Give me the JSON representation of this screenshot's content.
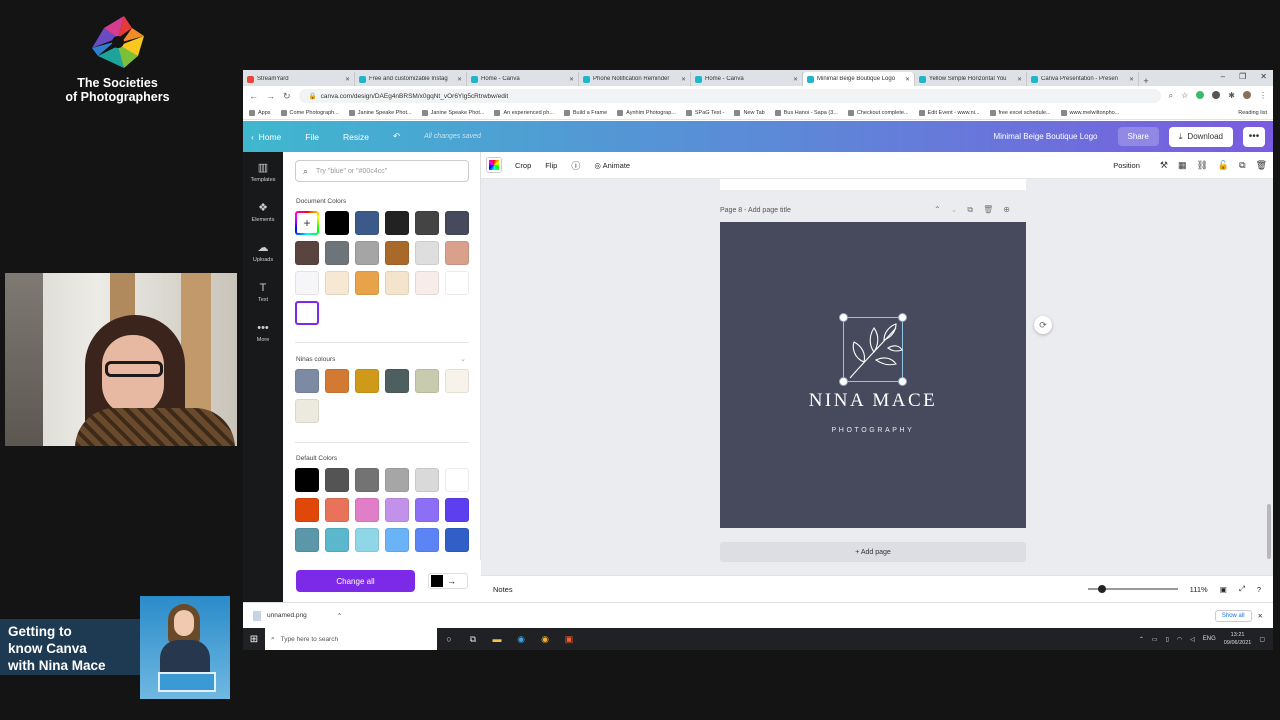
{
  "overlay": {
    "org_line1": "The Societies",
    "org_line2": "of Photographers",
    "promo_line1": "Getting to",
    "promo_line2": "know Canva",
    "promo_line3": "with Nina Mace"
  },
  "browser": {
    "tabs": [
      {
        "label": "StreamYard",
        "color": "#e8453c",
        "active": false
      },
      {
        "label": "Free and customizable Instag",
        "color": "#1fb6c9",
        "active": false
      },
      {
        "label": "Home - Canva",
        "color": "#1fb6c9",
        "active": false
      },
      {
        "label": "Phone Notification Reminder",
        "color": "#1fb6c9",
        "active": false
      },
      {
        "label": "Home - Canva",
        "color": "#1fb6c9",
        "active": false
      },
      {
        "label": "Minimal Beige Boutique Logo",
        "color": "#1fb6c9",
        "active": true
      },
      {
        "label": "Yellow Simple Horizontal You",
        "color": "#1fb6c9",
        "active": false
      },
      {
        "label": "Canva Presentation - Presen",
        "color": "#1fb6c9",
        "active": false
      }
    ],
    "new_tab": "+",
    "url": "canva.com/design/DAEg4nBRSM/x0gqNt_vOr6Ylg5cRtrwbw/edit",
    "bookmarks": [
      "Apps",
      "Come Photograph...",
      "Janine Speake Phot...",
      "Janine Speake Phot...",
      "An experienced ph...",
      "Build a Frame",
      "Aynhim Photograp...",
      "SPaG Test -",
      "New Tab",
      "Bus Hanoi - Sapa (3...",
      "Checkout complete...",
      "Edit Event - www.ni...",
      "free excel schedule...",
      "www.melwiltonpho..."
    ],
    "reading_list": "Reading list"
  },
  "canva": {
    "header": {
      "home": "Home",
      "file": "File",
      "resize": "Resize",
      "saved": "All changes saved",
      "design_title": "Minimal Beige Boutique Logo",
      "share": "Share",
      "download": "Download"
    },
    "rail": [
      {
        "label": "Templates",
        "icon": "▥"
      },
      {
        "label": "Elements",
        "icon": "❖"
      },
      {
        "label": "Uploads",
        "icon": "☁"
      },
      {
        "label": "Text",
        "icon": "T"
      },
      {
        "label": "More",
        "icon": "•••"
      }
    ],
    "panel": {
      "search_placeholder": "Try \"blue\" or \"#00c4cc\"",
      "document_title": "Document Colors",
      "document_colors": [
        "#000000",
        "#3b5a8a",
        "#222222",
        "#444444",
        "#474a5d",
        "#5a4440",
        "#6e757a",
        "#a5a5a5",
        "#a8692a",
        "#dedede",
        "#d9a08c",
        "#f6f6f8",
        "#f7e8d4",
        "#e8a34a",
        "#f4e4cc",
        "#f7ece9",
        "#ffffff"
      ],
      "ninas_title": "Ninas colours",
      "ninas_colors": [
        "#7c8aa3",
        "#d27a33",
        "#cf9a1a",
        "#4e5f5f",
        "#c8cbae",
        "#f8f3ea",
        "#ece9de"
      ],
      "default_title": "Default Colors",
      "default_colors": [
        "#000000",
        "#545454",
        "#737373",
        "#a6a6a6",
        "#d9d9d9",
        "#ffffff",
        "#e0480a",
        "#e8735a",
        "#e07fc8",
        "#c291ea",
        "#8c6ff5",
        "#5e3ff0",
        "#5a97a8",
        "#5bb7cc",
        "#8fd6e6",
        "#6ab3f7",
        "#5c84f5",
        "#2f5fc7"
      ],
      "change_all": "Change all"
    },
    "toolbar": {
      "crop": "Crop",
      "flip": "Flip",
      "animate": "Animate",
      "position": "Position"
    },
    "canvas": {
      "page_label": "Page 8 - Add page title",
      "brand_name": "NINA MACE",
      "brand_sub": "PHOTOGRAPHY",
      "add_page": "+ Add page",
      "background": "#474a5d"
    },
    "footer": {
      "notes": "Notes",
      "zoom": "111%",
      "zoom_level": 0.16
    }
  },
  "downloads": {
    "file": "unnamed.png",
    "show_all": "Show all"
  },
  "taskbar": {
    "search": "Type here to search",
    "lang": "ENG",
    "time": "13:21",
    "date": "09/06/2021"
  }
}
